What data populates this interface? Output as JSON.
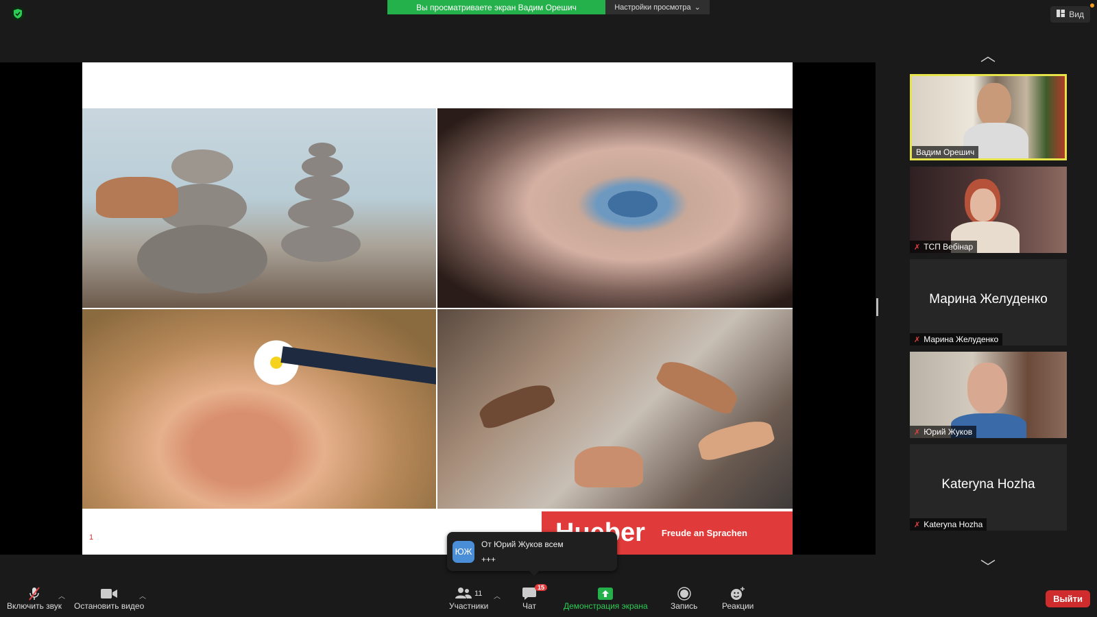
{
  "top": {
    "banner_text": "Вы просматриваете экран Вадим Орешич",
    "view_settings_label": "Настройки просмотра",
    "view_button_label": "Вид"
  },
  "slide": {
    "page_number": "1",
    "brand_name": "Hueber",
    "brand_tagline": "Freude an Sprachen"
  },
  "toast": {
    "avatar_initials": "ЮЖ",
    "from": "От Юрий Жуков всем",
    "message": "+++"
  },
  "participants": [
    {
      "name": "Вадим Орешич",
      "active": true,
      "muted": false,
      "video": true
    },
    {
      "name": "ТСП Вебінар",
      "active": false,
      "muted": true,
      "video": true
    },
    {
      "name": "Марина Желуденко",
      "active": false,
      "muted": true,
      "video": false
    },
    {
      "name": "Юрий Жуков",
      "active": false,
      "muted": true,
      "video": true
    },
    {
      "name": "Kateryna Hozha",
      "active": false,
      "muted": true,
      "video": false
    }
  ],
  "toolbar": {
    "unmute_label": "Включить звук",
    "stop_video_label": "Остановить видео",
    "participants_label": "Участники",
    "participants_count": "11",
    "chat_label": "Чат",
    "chat_badge": "15",
    "share_label": "Демонстрация экрана",
    "record_label": "Запись",
    "reactions_label": "Реакции",
    "exit_label": "Выйти"
  },
  "colors": {
    "share_green": "#24b14b",
    "active_speaker_border": "#e6e44a",
    "exit_red": "#cf2d2d",
    "brand_red": "#e03a3a"
  }
}
